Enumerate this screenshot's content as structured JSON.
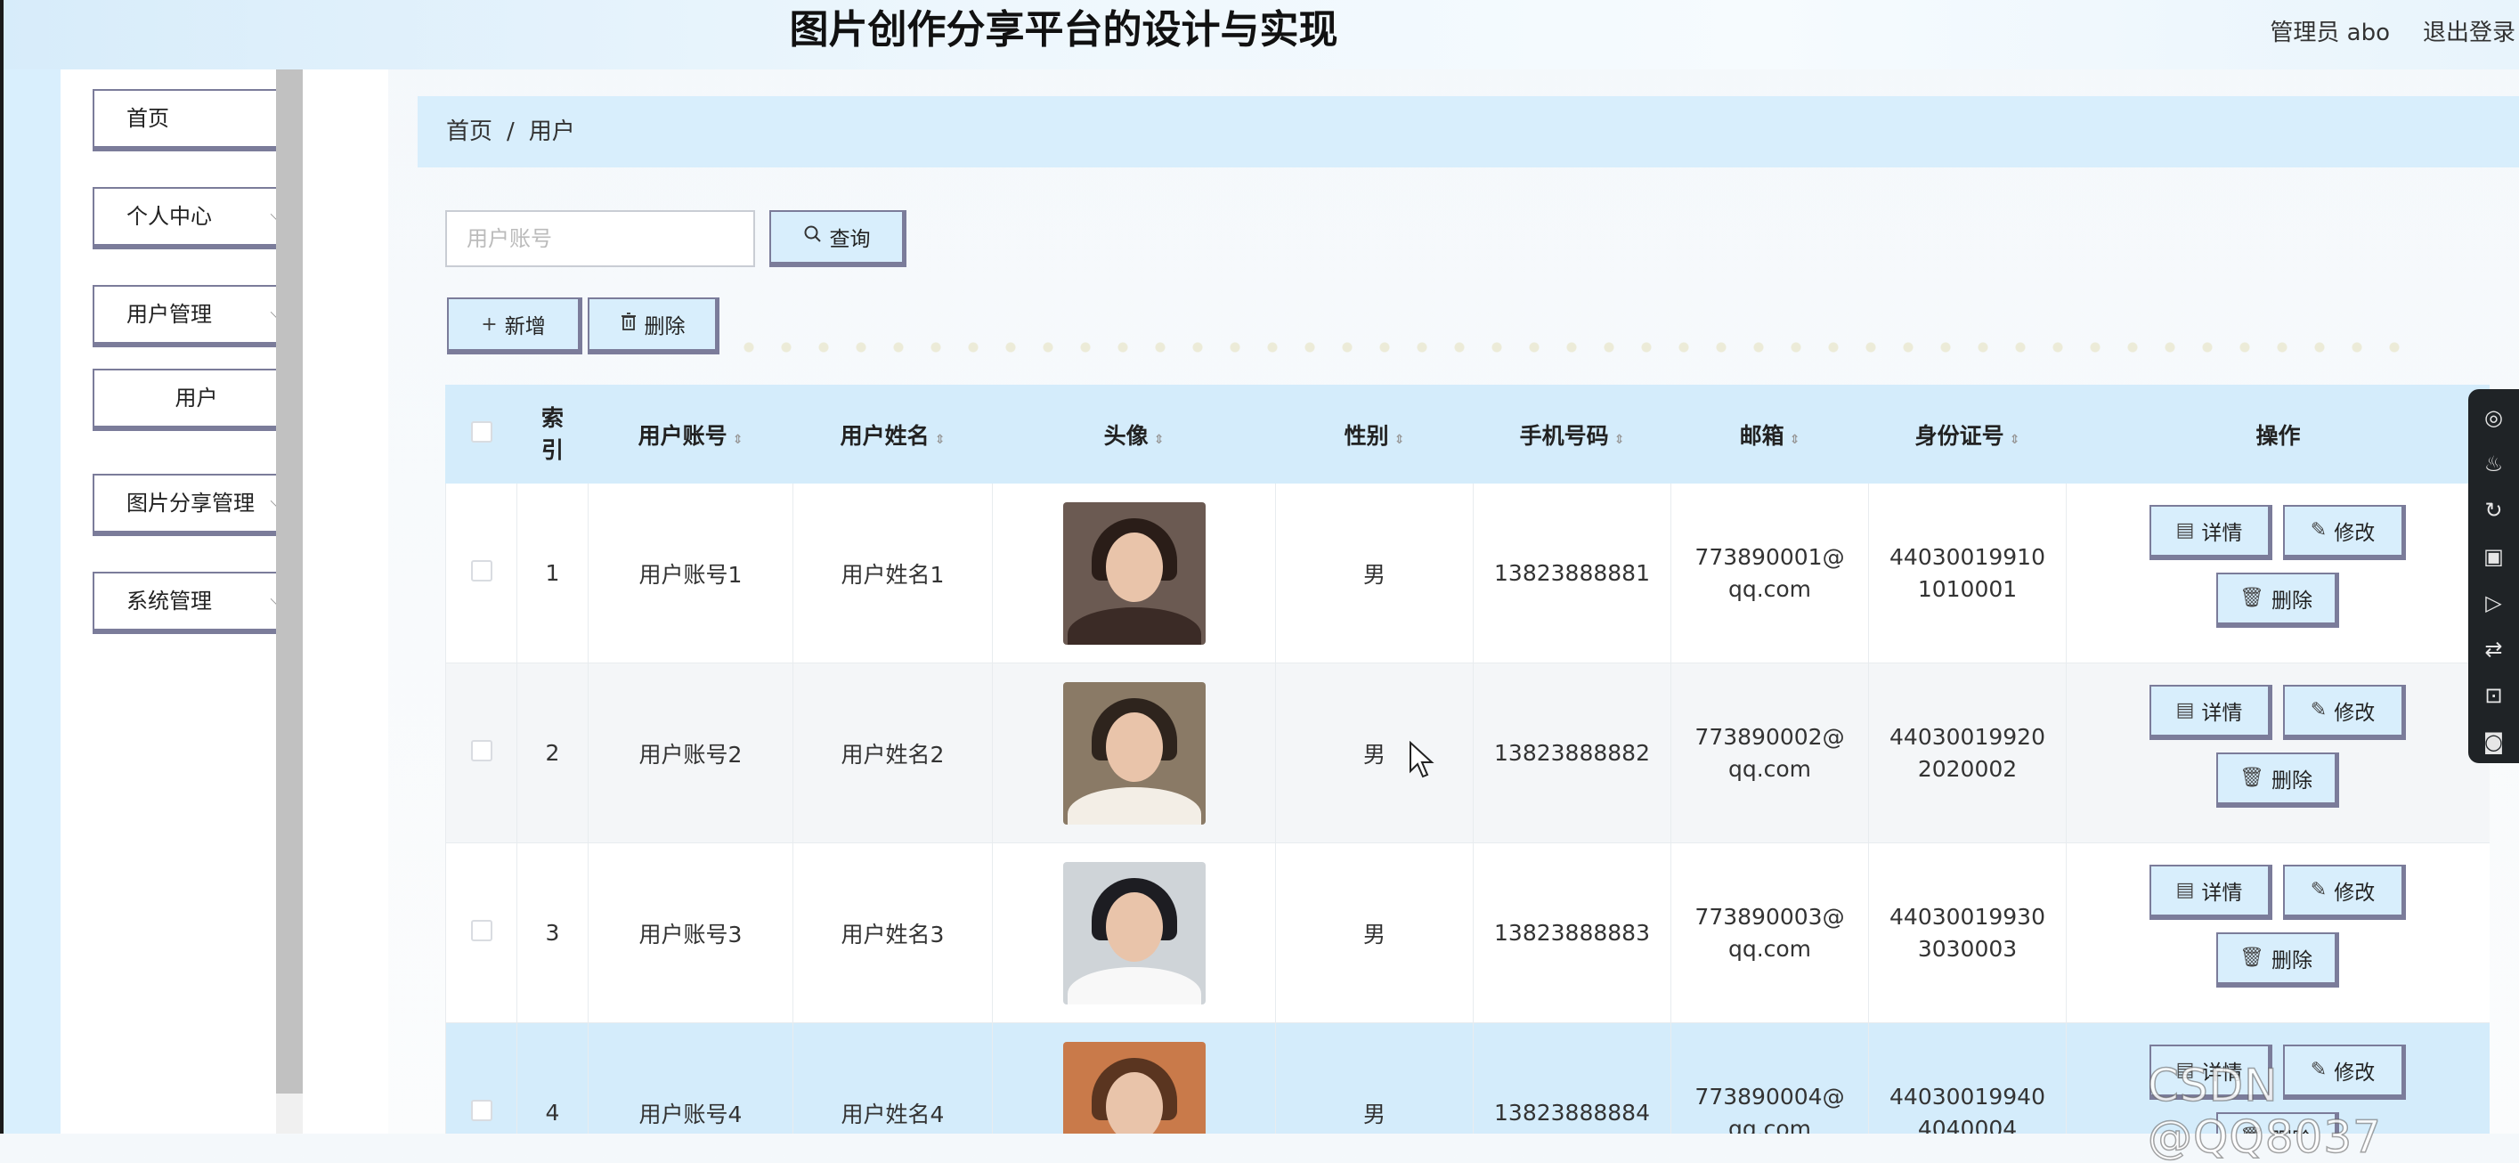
{
  "header": {
    "title": "图片创作分享平台的设计与实现",
    "admin": "管理员 abo",
    "logout": "退出登录"
  },
  "sidebar": {
    "items": [
      {
        "label": "首页"
      },
      {
        "label": "个人中心"
      },
      {
        "label": "用户管理"
      },
      {
        "label": "用户"
      },
      {
        "label": "图片分享管理"
      },
      {
        "label": "系统管理"
      }
    ],
    "chevron": "⌵"
  },
  "breadcrumb": {
    "home": "首页",
    "separator": "/",
    "current": "用户"
  },
  "search": {
    "placeholder": "用户账号",
    "button": "查询"
  },
  "toolbar": {
    "add": "新增",
    "delete": "删除"
  },
  "table": {
    "headers": {
      "index": "索引",
      "account": "用户账号",
      "name": "用户姓名",
      "avatar": "头像",
      "gender": "性别",
      "phone": "手机号码",
      "email": "邮箱",
      "idcard": "身份证号",
      "ops": "操作"
    },
    "rows": [
      {
        "index": "1",
        "account": "用户账号1",
        "name": "用户姓名1",
        "gender": "男",
        "phone": "13823888881",
        "email": "773890001@qq.com",
        "idcard": "440300199101010001"
      },
      {
        "index": "2",
        "account": "用户账号2",
        "name": "用户姓名2",
        "gender": "男",
        "phone": "13823888882",
        "email": "773890002@qq.com",
        "idcard": "440300199202020002"
      },
      {
        "index": "3",
        "account": "用户账号3",
        "name": "用户姓名3",
        "gender": "男",
        "phone": "13823888883",
        "email": "773890003@qq.com",
        "idcard": "440300199303030003"
      },
      {
        "index": "4",
        "account": "用户账号4",
        "name": "用户姓名4",
        "gender": "男",
        "phone": "13823888884",
        "email": "773890004@qq.com",
        "idcard": "440300199404040004"
      }
    ],
    "row_actions": {
      "detail": "详情",
      "edit": "修改",
      "delete": "删除"
    }
  },
  "watermark": "CSDN @QQ8037",
  "colors": {
    "accent": "#d8eefc",
    "border": "#7b7c9a",
    "header_row": "#d4ecfb"
  },
  "icons": {
    "floating_toolbar": [
      "search-target-icon",
      "fire-icon",
      "refresh-icon",
      "video-record-icon",
      "video-play-icon",
      "swap-icon",
      "crop-icon",
      "camera-icon"
    ]
  }
}
